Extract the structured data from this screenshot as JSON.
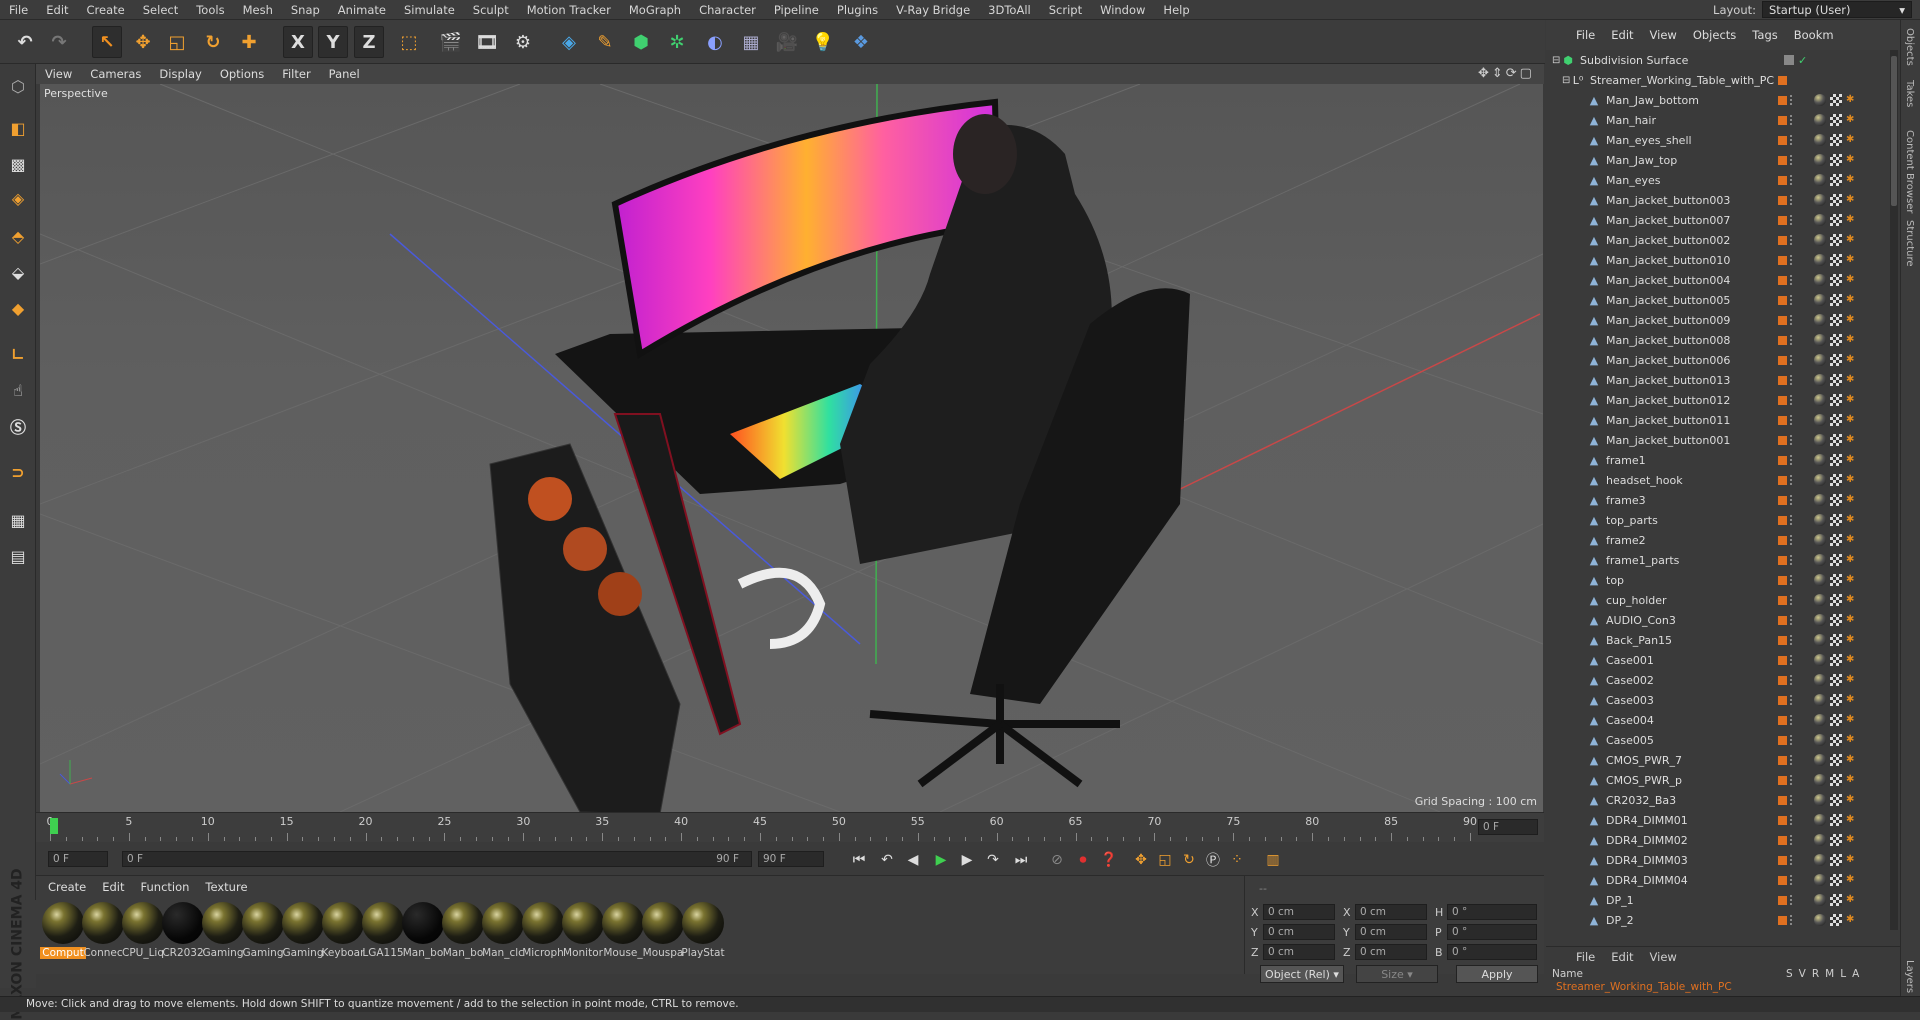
{
  "menubar": {
    "items": [
      "File",
      "Edit",
      "Create",
      "Select",
      "Tools",
      "Mesh",
      "Snap",
      "Animate",
      "Simulate",
      "Sculpt",
      "Motion Tracker",
      "MoGraph",
      "Character",
      "Pipeline",
      "Plugins",
      "V-Ray Bridge",
      "3DToAll",
      "Script",
      "Window",
      "Help"
    ],
    "layout_label": "Layout:",
    "layout_value": "Startup (User)"
  },
  "toolbar": {
    "icons": [
      "undo-icon",
      "redo-icon",
      "live-selection-icon",
      "move-icon",
      "scale-icon",
      "rotate-icon",
      "add-icon",
      "x-axis-icon",
      "y-axis-icon",
      "z-axis-icon",
      "coordinate-system-icon",
      "render-view-icon",
      "render-picture-viewer-icon",
      "edit-render-settings-icon",
      "cube-icon",
      "pen-icon",
      "subdivision-icon",
      "array-icon",
      "deformer-icon",
      "floor-icon",
      "camera-icon",
      "light-icon",
      "python-icon"
    ],
    "axis_x": "X",
    "axis_y": "Y",
    "axis_z": "Z"
  },
  "viewport": {
    "menu": [
      "View",
      "Cameras",
      "Display",
      "Options",
      "Filter",
      "Panel"
    ],
    "label": "Perspective",
    "grid_spacing": "Grid Spacing : 100 cm"
  },
  "timeline": {
    "ticks": [
      "0",
      "5",
      "10",
      "15",
      "20",
      "25",
      "30",
      "35",
      "40",
      "45",
      "50",
      "55",
      "60",
      "65",
      "70",
      "75",
      "80",
      "85",
      "90"
    ],
    "frame_current": "0 F"
  },
  "transport": {
    "start_field": "0 F",
    "range_start": "0 F",
    "range_end": "90 F",
    "end_field": "90 F"
  },
  "materials": {
    "menu": [
      "Create",
      "Edit",
      "Function",
      "Texture"
    ],
    "items": [
      {
        "label": "Comput",
        "dark": false
      },
      {
        "label": "Connec",
        "dark": false
      },
      {
        "label": "CPU_Liq",
        "dark": false
      },
      {
        "label": "CR2032",
        "dark": true
      },
      {
        "label": "Gaming",
        "dark": false
      },
      {
        "label": "Gaming",
        "dark": false
      },
      {
        "label": "Gaming",
        "dark": false
      },
      {
        "label": "Keyboar",
        "dark": false
      },
      {
        "label": "LGA115",
        "dark": false
      },
      {
        "label": "Man_bo",
        "dark": true
      },
      {
        "label": "Man_bo",
        "dark": false
      },
      {
        "label": "Man_clc",
        "dark": false
      },
      {
        "label": "Microph",
        "dark": false
      },
      {
        "label": "Monitor",
        "dark": false
      },
      {
        "label": "Mouse_",
        "dark": false
      },
      {
        "label": "Mouspa",
        "dark": false
      },
      {
        "label": "PlayStat",
        "dark": false
      }
    ]
  },
  "coords": {
    "header": "--",
    "x": "0 cm",
    "y": "0 cm",
    "z": "0 cm",
    "sx": "0 cm",
    "sy": "0 cm",
    "sz": "0 cm",
    "h": "0 °",
    "p": "0 °",
    "b": "0 °",
    "mode": "Object (Rel)",
    "size_mode": "Size",
    "apply": "Apply"
  },
  "brand": "MAXON CINEMA 4D",
  "status": "Move: Click and drag to move elements. Hold down SHIFT to quantize movement / add to the selection in point mode, CTRL to remove.",
  "object_manager": {
    "menu": [
      "File",
      "Edit",
      "View",
      "Objects",
      "Tags",
      "Bookm"
    ],
    "root": "Subdivision Surface",
    "group": "Streamer_Working_Table_with_PC",
    "objects": [
      "Man_Jaw_bottom",
      "Man_hair",
      "Man_eyes_shell",
      "Man_Jaw_top",
      "Man_eyes",
      "Man_jacket_button003",
      "Man_jacket_button007",
      "Man_jacket_button002",
      "Man_jacket_button010",
      "Man_jacket_button004",
      "Man_jacket_button005",
      "Man_jacket_button009",
      "Man_jacket_button008",
      "Man_jacket_button006",
      "Man_jacket_button013",
      "Man_jacket_button012",
      "Man_jacket_button011",
      "Man_jacket_button001",
      "frame1",
      "headset_hook",
      "frame3",
      "top_parts",
      "frame2",
      "frame1_parts",
      "top",
      "cup_holder",
      "AUDIO_Con3",
      "Back_Pan15",
      "Case001",
      "Case002",
      "Case003",
      "Case004",
      "Case005",
      "CMOS_PWR_7",
      "CMOS_PWR_p",
      "CR2032_Ba3",
      "DDR4_DIMM01",
      "DDR4_DIMM02",
      "DDR4_DIMM03",
      "DDR4_DIMM04",
      "DP_1",
      "DP_2"
    ]
  },
  "layers": {
    "menu": [
      "File",
      "Edit",
      "View"
    ],
    "name_header": "Name",
    "cols": [
      "S",
      "V",
      "R",
      "M",
      "L",
      "A"
    ],
    "row": "Streamer_Working_Table_with_PC"
  },
  "right_tabs": [
    "Objects",
    "Takes",
    "Content Browser",
    "Structure",
    "Layers"
  ]
}
